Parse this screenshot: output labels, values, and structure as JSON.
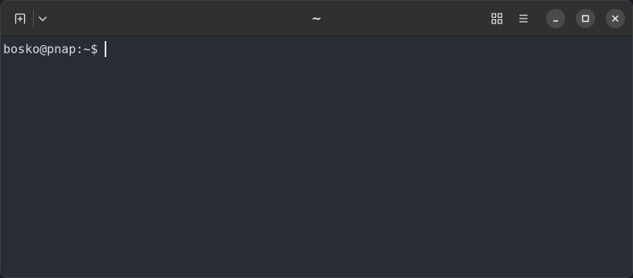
{
  "window": {
    "title": "~"
  },
  "titlebar": {
    "new_tab_icon": "new-tab-icon",
    "menu_dropdown_icon": "chevron-down-icon",
    "overview_icon": "grid-icon",
    "menu_icon": "hamburger-menu-icon",
    "minimize_icon": "minimize-icon",
    "maximize_icon": "maximize-icon",
    "close_icon": "close-icon"
  },
  "terminal": {
    "prompt": "bosko@pnap:~$",
    "input": "",
    "background": "#282c34",
    "foreground": "#d7dae0"
  }
}
